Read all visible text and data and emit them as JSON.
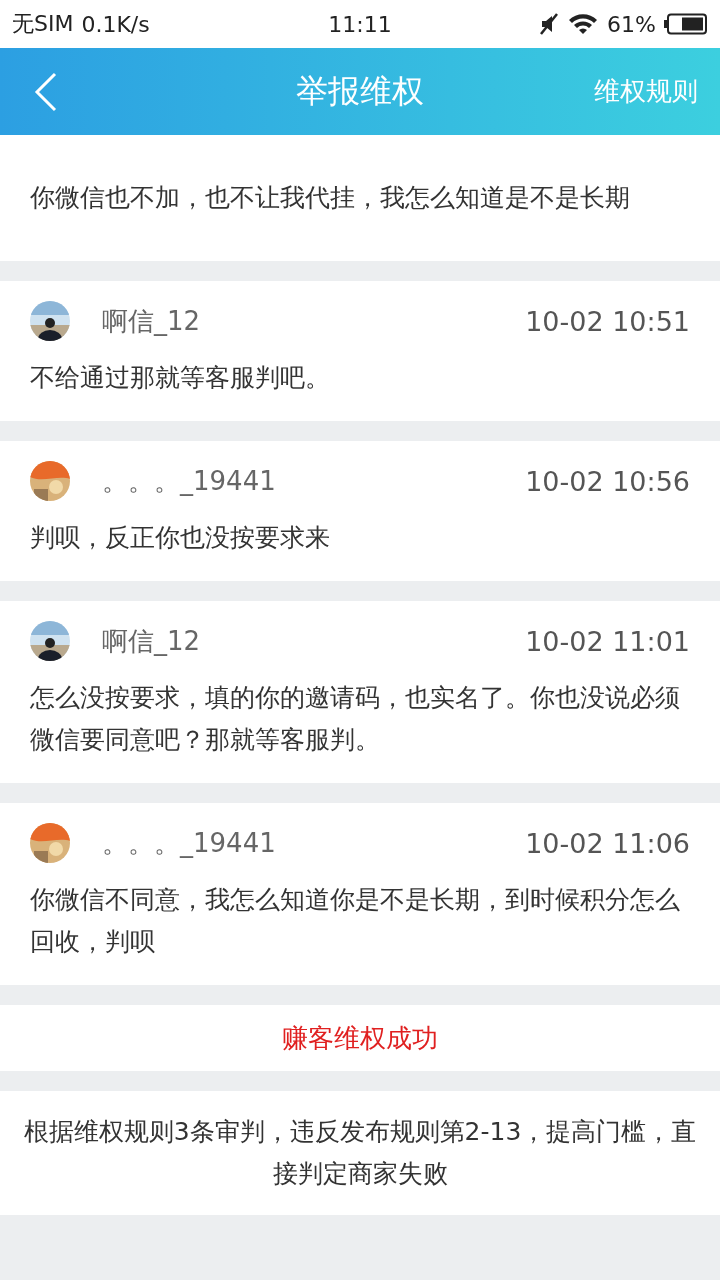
{
  "status_bar": {
    "carrier": "无SIM",
    "speed": "0.1K/s",
    "time": "11:11",
    "battery": "61%"
  },
  "nav": {
    "title": "举报维权",
    "action": "维权规则"
  },
  "partial_message": {
    "text": "你微信也不加，也不让我代挂，我怎么知道是不是长期"
  },
  "messages": [
    {
      "author": "啊信_12",
      "time": "10-02 10:51",
      "text": "不给通过那就等客服判吧。"
    },
    {
      "author": "。。。_19441",
      "time": "10-02 10:56",
      "text": "判呗，反正你也没按要求来"
    },
    {
      "author": "啊信_12",
      "time": "10-02 11:01",
      "text": "怎么没按要求，填的你的邀请码，也实名了。你也没说必须微信要同意吧？那就等客服判。"
    },
    {
      "author": "。。。_19441",
      "time": "10-02 11:06",
      "text": "你微信不同意，我怎么知道你是不是长期，到时候积分怎么回收，判呗"
    }
  ],
  "result": "赚客维权成功",
  "verdict": "根据维权规则3条审判，违反发布规则第2-13，提高门槛，直接判定商家失败"
}
